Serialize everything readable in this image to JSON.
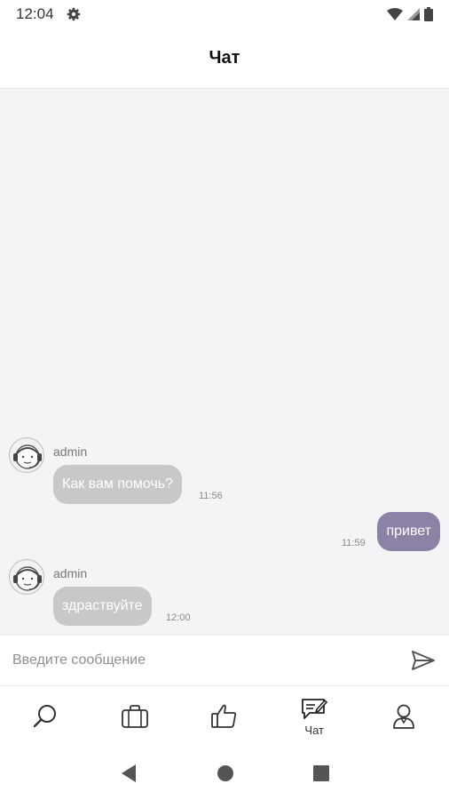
{
  "status_bar": {
    "time": "12:04"
  },
  "header": {
    "title": "Чат"
  },
  "messages": [
    {
      "sender": "admin",
      "text": "Как вам помочь?",
      "time": "11:56",
      "direction": "incoming"
    },
    {
      "text": "привет",
      "time": "11:59",
      "direction": "outgoing"
    },
    {
      "sender": "admin",
      "text": "здраствуйте",
      "time": "12:00",
      "direction": "incoming"
    }
  ],
  "composer": {
    "placeholder": "Введите сообщение"
  },
  "tabs": [
    {
      "icon": "search-icon",
      "label": ""
    },
    {
      "icon": "briefcase-icon",
      "label": ""
    },
    {
      "icon": "thumbs-up-icon",
      "label": ""
    },
    {
      "icon": "chat-icon",
      "label": "Чат"
    },
    {
      "icon": "profile-icon",
      "label": ""
    }
  ],
  "colors": {
    "incoming_bubble": "#c8c8c8",
    "outgoing_bubble": "#8b82a6",
    "chat_background": "#f4f4f7"
  }
}
